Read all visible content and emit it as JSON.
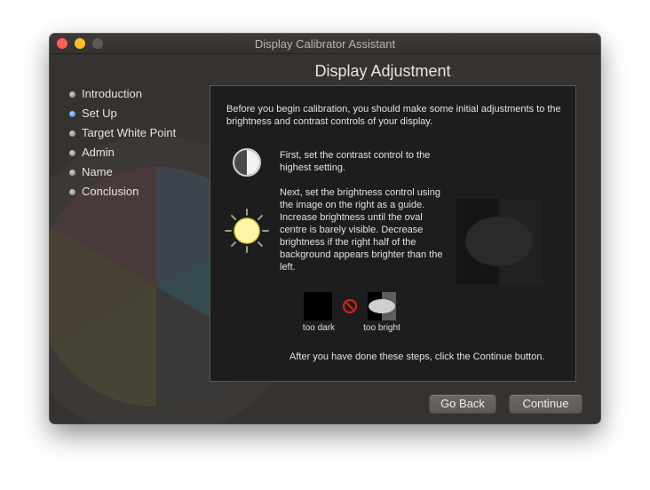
{
  "window": {
    "title": "Display Calibrator Assistant"
  },
  "page": {
    "title": "Display Adjustment"
  },
  "steps": [
    {
      "label": "Introduction",
      "state": "done"
    },
    {
      "label": "Set Up",
      "state": "current"
    },
    {
      "label": "Target White Point",
      "state": "pending"
    },
    {
      "label": "Admin",
      "state": "pending"
    },
    {
      "label": "Name",
      "state": "pending"
    },
    {
      "label": "Conclusion",
      "state": "pending"
    }
  ],
  "content": {
    "intro": "Before you begin calibration, you should make some initial adjustments to the brightness and contrast controls of your display.",
    "contrast_text": "First, set the contrast control to the highest setting.",
    "brightness_text": "Next, set the brightness control using the image on the right as a guide. Increase brightness until the oval centre is barely visible. Decrease brightness if the right half of the background appears brighter than the left.",
    "too_dark_label": "too dark",
    "too_bright_label": "too bright",
    "after_text": "After you have done these steps, click the Continue button."
  },
  "buttons": {
    "back": "Go Back",
    "continue": "Continue"
  },
  "icons": {
    "contrast": "contrast-icon",
    "brightness": "sun-icon",
    "prohibited": "prohibited-icon"
  },
  "colors": {
    "close": "#fd5f57",
    "minimize": "#febc2e",
    "active_step": "#2e7fe0",
    "window_bg": "#36322f",
    "content_bg": "#1d1d1d"
  }
}
